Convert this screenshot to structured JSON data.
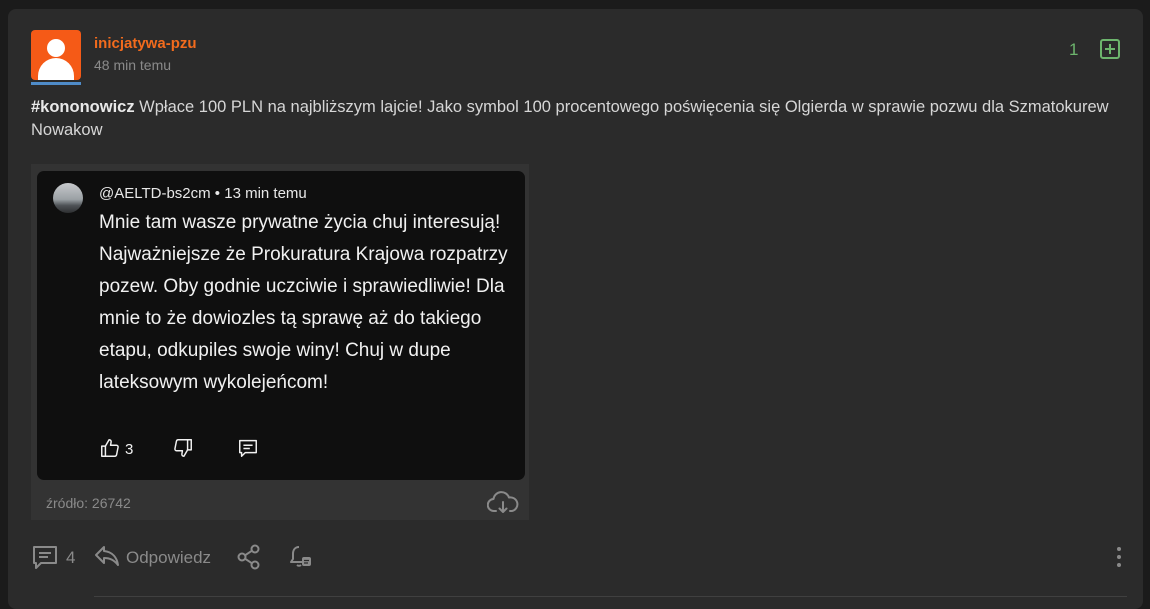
{
  "post": {
    "author": "inicjatywa-pzu",
    "time": "48 min temu",
    "score": "1",
    "tag": "#kononowicz",
    "text": " Wpłace 100 PLN na najbliższym lajcie! Jako symbol 100 procentowego poświęcenia się Olgierda w sprawie pozwu dla Szmatokurew Nowakow"
  },
  "embed": {
    "header": "@AELTD-bs2cm • 13 min temu",
    "body": "Mnie tam wasze prywatne życia chuj interesują! Najważniejsze że Prokuratura Krajowa rozpatrzy pozew. Oby godnie uczciwie i sprawiedliwie!  Dla mnie to że dowiozles tą sprawę aż do takiego etapu, odkupiles swoje winy! Chuj w dupe lateksowym wykolejeńcom!",
    "likes": "3",
    "source": "źródło: 26742"
  },
  "footer": {
    "comment_count": "4",
    "reply_label": "Odpowiedz"
  },
  "colors": {
    "background": "#1b1b1b",
    "card": "#2b2b2b",
    "author": "#f26b1d",
    "vote": "#6db56d",
    "muted": "#8a8a8a"
  },
  "icons": [
    "plus-vote-icon",
    "like-icon",
    "dislike-icon",
    "reply-comment-icon",
    "cloud-download-icon",
    "comments-icon",
    "reply-arrow-icon",
    "share-icon",
    "bell-icon",
    "more-icon"
  ]
}
